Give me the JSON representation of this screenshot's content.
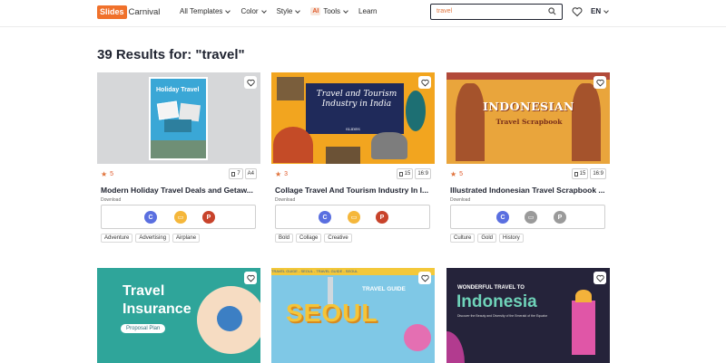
{
  "header": {
    "logo_main": "Slides",
    "logo_rest": "Carnival",
    "nav": [
      {
        "label": "All Templates",
        "has_chevron": true
      },
      {
        "label": "Color",
        "has_chevron": true
      },
      {
        "label": "Style",
        "has_chevron": true
      },
      {
        "label": "Tools",
        "badge": "AI",
        "has_chevron": true
      },
      {
        "label": "Learn",
        "has_chevron": false
      }
    ],
    "search_value": "travel",
    "language": "EN"
  },
  "results_title": "39 Results for: \"travel\"",
  "cards": [
    {
      "title": "Modern Holiday Travel Deals and Getaw...",
      "thumb_text": "Holiday Travel",
      "rating": "5",
      "slides": "7",
      "format": "A4",
      "download_label": "Download",
      "tags": [
        "Adventure",
        "Advertising",
        "Airplane"
      ]
    },
    {
      "title": "Collage Travel And Tourism Industry In I...",
      "thumb_text": "Travel and Tourism Industry in India",
      "thumb_sub": "SLIDES",
      "rating": "3",
      "slides": "15",
      "format": "16:9",
      "download_label": "Download",
      "tags": [
        "Bold",
        "Collage",
        "Creative"
      ]
    },
    {
      "title": "Illustrated Indonesian Travel Scrapbook ...",
      "thumb_text": "INDONESIAN",
      "thumb_sub": "Travel Scrapbook",
      "rating": "5",
      "slides": "15",
      "format": "16:9",
      "download_label": "Download",
      "tags": [
        "Culture",
        "Gold",
        "History"
      ]
    },
    {
      "thumb_text": "Travel Insurance",
      "thumb_sub": "Proposal Plan"
    },
    {
      "thumb_text": "SEOUL",
      "thumb_sub": "TRAVEL GUIDE",
      "banner": "TRAVEL GUIDE - SEOUL - TRAVEL GUIDE - SEOUL"
    },
    {
      "thumb_text": "Indonesia",
      "thumb_sub": "WONDERFUL TRAVEL TO",
      "thumb_caption": "Discover the Beauty and Diversity of the Emerald of the Equator"
    }
  ],
  "colors": {
    "brand": "#f0712b",
    "google_slides": "#f5b73b",
    "powerpoint": "#c8432b",
    "canva": "#5a6fe0"
  }
}
